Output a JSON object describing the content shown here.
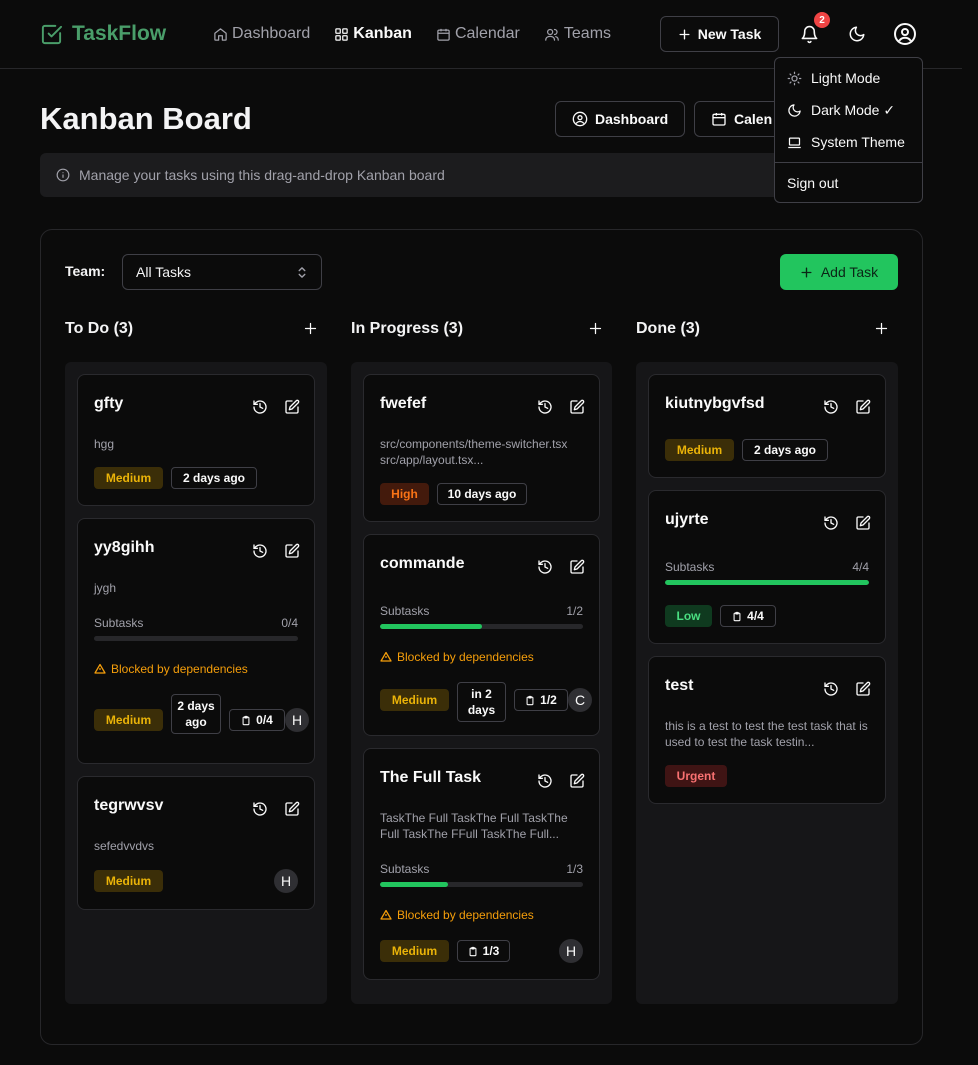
{
  "app": {
    "brand": "TaskFlow",
    "notification_count": "2"
  },
  "nav": [
    {
      "label": "Dashboard",
      "icon": "home-icon"
    },
    {
      "label": "Kanban",
      "icon": "kanban-icon"
    },
    {
      "label": "Calendar",
      "icon": "calendar-icon"
    },
    {
      "label": "Teams",
      "icon": "users-icon"
    }
  ],
  "header": {
    "new_task": "New Task"
  },
  "page": {
    "title": "Kanban Board",
    "btn_dashboard": "Dashboard",
    "btn_calendar": "Calen",
    "info": "Manage your tasks using this drag-and-drop Kanban board"
  },
  "filter": {
    "team_label": "Team:",
    "team_value": "All Tasks",
    "add_task": "Add Task"
  },
  "columns": [
    {
      "title": "To Do (3)"
    },
    {
      "title": "In Progress (3)"
    },
    {
      "title": "Done (3)"
    }
  ],
  "cards": {
    "gfty": {
      "title": "gfty",
      "desc": "hgg",
      "priority": "Medium",
      "time": "2 days ago"
    },
    "yy8gihh": {
      "title": "yy8gihh",
      "desc": "jygh",
      "subtasks_label": "Subtasks",
      "subtasks": "0/4",
      "progress": 0,
      "blocked": "Blocked by dependencies",
      "priority": "Medium",
      "time": "2 days ago",
      "count": "0/4",
      "avatar": "H"
    },
    "tegrwvsv": {
      "title": "tegrwvsv",
      "desc": "sefedvvdvs",
      "priority": "Medium",
      "avatar": "H"
    },
    "fwefef": {
      "title": "fwefef",
      "desc": "src/components/theme-switcher.tsx src/app/layout.tsx...",
      "priority": "High",
      "time": "10 days ago"
    },
    "commande": {
      "title": "commande",
      "subtasks_label": "Subtasks",
      "subtasks": "1/2",
      "progress": 0.5,
      "blocked": "Blocked by dependencies",
      "priority": "Medium",
      "time": "in 2 days",
      "count": "1/2",
      "avatar": "C"
    },
    "fulltask": {
      "title": "The Full Task",
      "desc": "TaskThe Full TaskThe Full TaskThe Full TaskThe FFull TaskThe Full...",
      "subtasks_label": "Subtasks",
      "subtasks": "1/3",
      "progress": 0.333,
      "blocked": "Blocked by dependencies",
      "priority": "Medium",
      "count": "1/3",
      "avatar": "H"
    },
    "kiutnybgvfsd": {
      "title": "kiutnybgvfsd",
      "priority": "Medium",
      "time": "2 days ago"
    },
    "ujyrte": {
      "title": "ujyrte",
      "subtasks_label": "Subtasks",
      "subtasks": "4/4",
      "progress": 1,
      "priority": "Low",
      "count": "4/4"
    },
    "test": {
      "title": "test",
      "desc": "this is a test to test the test task that is used to test the task testin...",
      "priority": "Urgent"
    }
  },
  "menu": {
    "light": "Light Mode",
    "dark": "Dark Mode ✓",
    "system": "System Theme",
    "signout": "Sign out"
  },
  "colors": {
    "accent": "#22c55e",
    "brand": "#4a9e6a",
    "warning": "#f59e0b",
    "danger": "#ef4444"
  }
}
